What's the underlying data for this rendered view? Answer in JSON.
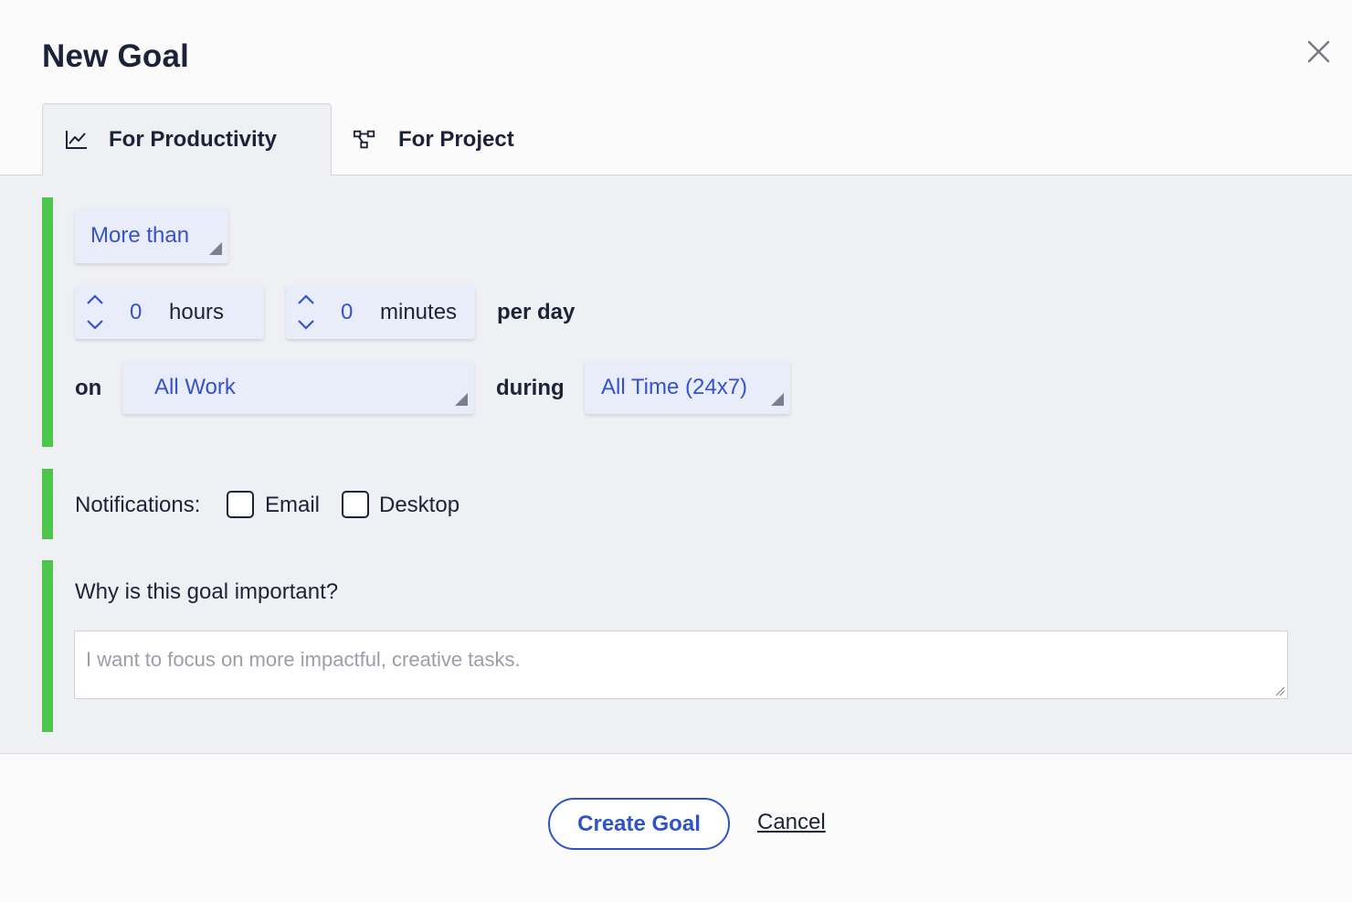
{
  "dialog": {
    "title": "New Goal",
    "close_icon": "close-icon"
  },
  "tabs": [
    {
      "label": "For Productivity",
      "icon": "line-chart-icon",
      "active": true
    },
    {
      "label": "For Project",
      "icon": "project-nodes-icon",
      "active": false
    }
  ],
  "goal": {
    "comparison": "More than",
    "hours_value": "0",
    "hours_unit": "hours",
    "minutes_value": "0",
    "minutes_unit": "minutes",
    "period": "per day",
    "on_label": "on",
    "scope": "All Work",
    "during_label": "during",
    "schedule": "All Time (24x7)"
  },
  "notifications": {
    "label": "Notifications:",
    "email_label": "Email",
    "email_checked": false,
    "desktop_label": "Desktop",
    "desktop_checked": false
  },
  "importance": {
    "question": "Why is this goal important?",
    "placeholder": "I want to focus on more impactful, creative tasks."
  },
  "footer": {
    "create_label": "Create Goal",
    "cancel_label": "Cancel"
  },
  "colors": {
    "accent": "#2f54c9",
    "select_text": "#3552c9",
    "section_bar": "#4cc64a",
    "panel_bg": "#eff0f4"
  }
}
